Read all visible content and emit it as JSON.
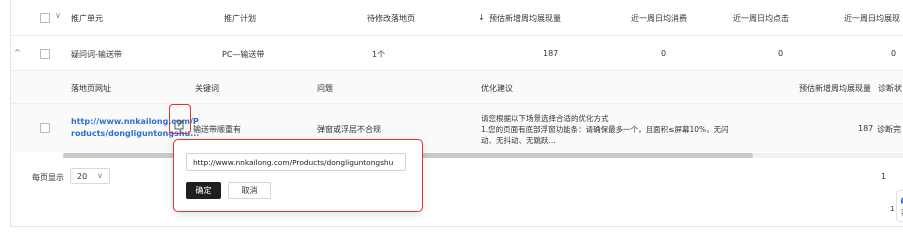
{
  "header": {
    "col_unit": "推广单元",
    "col_plan": "推广计划",
    "col_pending": "待修改落地页",
    "sort_arrow": "↓",
    "col_forecast": "预估新增周均展现量",
    "col_cost": "近一周日均消费",
    "col_clicks": "近一周日均点击",
    "col_impr": "近一周日均展现"
  },
  "row": {
    "expand_icon": "^",
    "unit": "疑问词-输送带",
    "plan": "PC—输送带",
    "pending": "1个",
    "forecast": "187",
    "cost": "0",
    "clicks": "0",
    "impr": "0"
  },
  "subheader": {
    "col_url": "落地页网址",
    "col_keyword": "关键词",
    "col_issue": "问题",
    "col_suggestion": "优化建议",
    "col_forecast": "预估新增周均展现量",
    "col_diagnose": "诊断状"
  },
  "subrow": {
    "url_line1": "http://www.nnkailong.com/P",
    "url_line2": "roducts/dongliguntongshu...",
    "keyword": "输送带顺重有",
    "issue": "弹窗或浮层不合规",
    "suggestion_line1": "请您根据以下场景选择合适的优化方式",
    "suggestion_line2": "1.您的页面有底部浮窗功能条：请确保最多一个，且面积≤屏幕10%，无闪",
    "suggestion_line3": "动、无抖动、无跳跃...",
    "forecast": "187",
    "diagnose": "诊断完"
  },
  "pager": {
    "per_page_label": "每页显示",
    "per_page_value": "20",
    "page_number": "1"
  },
  "popup": {
    "url_value": "http://www.nnkailong.com/Products/dongliguntongshu",
    "ok_label": "确定",
    "cancel_label": "取消"
  },
  "float_button": {
    "label": "客",
    "page_hint": "1"
  },
  "colors": {
    "link": "#2f6fd6",
    "highlight": "#e3342f",
    "primary_button": "#1f1f1f"
  }
}
